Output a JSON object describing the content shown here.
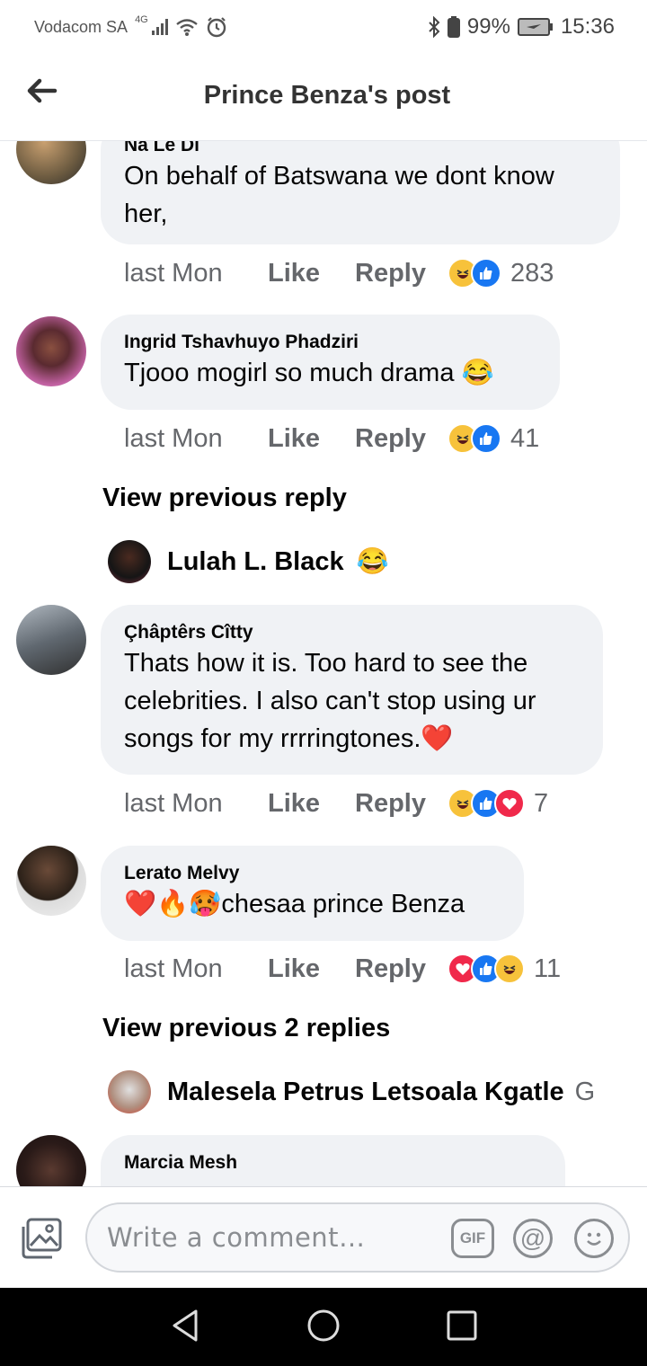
{
  "status": {
    "carrier": "Vodacom SA",
    "network": "4G",
    "battery": "99%",
    "time": "15:36"
  },
  "header": {
    "title": "Prince Benza's post"
  },
  "comments": [
    {
      "name": "Na Le Di",
      "text": "On behalf of Batswana we dont know her,",
      "time": "last Mon",
      "like": "Like",
      "reply": "Reply",
      "reactions": [
        "haha",
        "like"
      ],
      "count": "283",
      "avatar_color": "#6b5a40"
    },
    {
      "name": "Ingrid Tshavhuyo Phadziri",
      "text": "Tjooo mogirl so much drama 😂",
      "time": "last Mon",
      "like": "Like",
      "reply": "Reply",
      "reactions": [
        "haha",
        "like"
      ],
      "count": "41",
      "avatar_color": "#a0406a"
    },
    {
      "name": "Çhâptêrs Cîtty",
      "text": "Thats how it is. Too hard to see the celebrities. I also can't stop using ur songs for my rrrringtones.❤️",
      "time": "last Mon",
      "like": "Like",
      "reply": "Reply",
      "reactions": [
        "haha",
        "like",
        "love"
      ],
      "count": "7",
      "avatar_color": "#5a6470"
    },
    {
      "name": "Lerato Melvy",
      "text": "❤️🔥🥵chesaa prince Benza",
      "time": "last Mon",
      "like": "Like",
      "reply": "Reply",
      "reactions": [
        "love",
        "like",
        "haha"
      ],
      "count": "11",
      "avatar_color": "#3a3028"
    },
    {
      "name": "Marcia Mesh",
      "text": "",
      "avatar_color": "#2a2220"
    }
  ],
  "view_prev_1": "View previous reply",
  "reply_1": {
    "name": "Lulah L. Black",
    "emoji": "😂",
    "avatar_color": "#3a2a30"
  },
  "view_prev_2": "View previous 2 replies",
  "reply_2": {
    "name": "Malesela Petrus Letsoala Kgatle",
    "trail": "G",
    "avatar_color": "#c0a090"
  },
  "composer": {
    "placeholder": "Write a comment…",
    "gif_label": "GIF",
    "mention_label": "@"
  }
}
